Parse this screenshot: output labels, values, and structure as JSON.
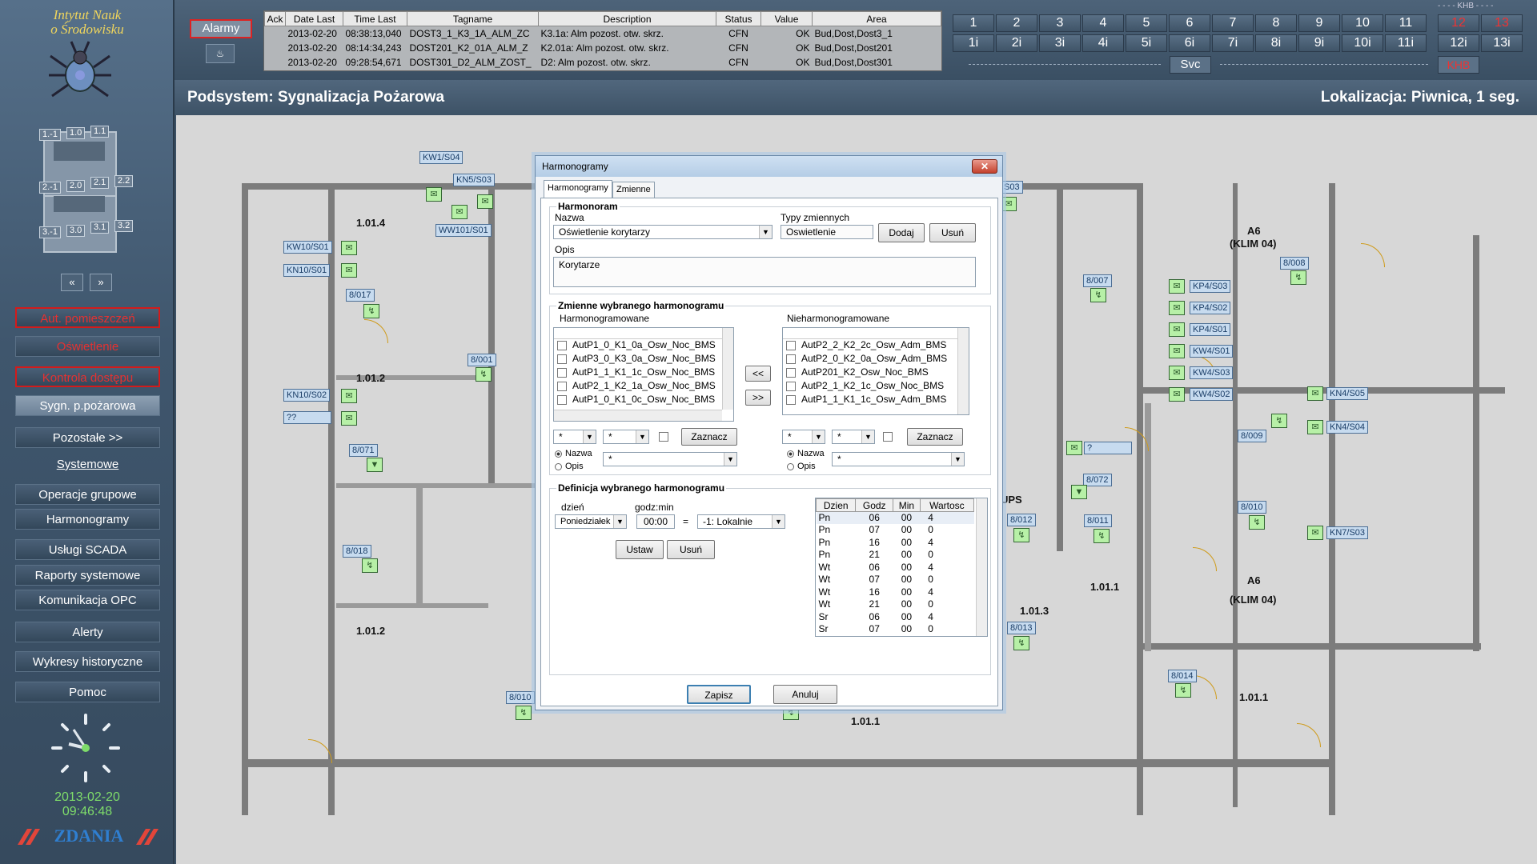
{
  "sidebar": {
    "logo_line1": "Intytut Nauk",
    "logo_line2": "o Środowisku",
    "floor_labels": [
      "1.-1",
      "1.0",
      "1.1",
      "2.-1",
      "2.0",
      "2.1",
      "2.2",
      "3.-1",
      "3.0",
      "3.1",
      "3.2"
    ],
    "prev_label": "«",
    "next_label": "»",
    "menu": [
      {
        "label": "Aut. pomieszczeń",
        "style": "red"
      },
      {
        "label": "Oświetlenie",
        "style": "redtext"
      },
      {
        "label": "Kontrola dostępu",
        "style": "red"
      },
      {
        "label": "Sygn. p.pożarowa",
        "style": "active"
      },
      {
        "label": "Pozostałe  >>",
        "style": "normal"
      },
      {
        "label": "Systemowe",
        "style": "link"
      },
      {
        "label": "Operacje grupowe",
        "style": "normal"
      },
      {
        "label": "Harmonogramy",
        "style": "normal"
      },
      {
        "label": "Usługi SCADA",
        "style": "normal"
      },
      {
        "label": "Raporty systemowe",
        "style": "normal"
      },
      {
        "label": "Komunikacja OPC",
        "style": "normal"
      },
      {
        "label": "Alerty",
        "style": "normal"
      },
      {
        "label": "Wykresy historyczne",
        "style": "normal"
      },
      {
        "label": "Pomoc",
        "style": "normal"
      }
    ],
    "date": "2013-02-20",
    "time": "09:46:48",
    "brand": "ZDANIA"
  },
  "topbar": {
    "alarm_button": "Alarmy",
    "table_headers": [
      "Ack",
      "Date Last",
      "Time Last",
      "Tagname",
      "Description",
      "Status",
      "Value",
      "Area"
    ],
    "alarms": [
      {
        "ack": "",
        "date": "2013-02-20",
        "time": "08:38:13,040",
        "tag": "DOST3_1_K3_1A_ALM_ZC",
        "desc": "K3.1a: Alm pozost. otw. skrz.",
        "status": "CFN",
        "value": "OK",
        "area": "Bud,Dost,Dost3_1"
      },
      {
        "ack": "",
        "date": "2013-02-20",
        "time": "08:14:34,243",
        "tag": "DOST201_K2_01A_ALM_Z",
        "desc": "K2.01a: Alm pozost. otw. skrz.",
        "status": "CFN",
        "value": "OK",
        "area": "Bud,Dost,Dost201"
      },
      {
        "ack": "",
        "date": "2013-02-20",
        "time": "09:28:54,671",
        "tag": "DOST301_D2_ALM_ZOST_",
        "desc": "D2: Alm pozost. otw. skrz.",
        "status": "CFN",
        "value": "OK",
        "area": "Bud,Dost,Dost301"
      }
    ],
    "floors_top": [
      "1",
      "2",
      "3",
      "4",
      "5",
      "6",
      "7",
      "8",
      "9",
      "10",
      "11",
      "12",
      "13"
    ],
    "floors_bottom": [
      "1i",
      "2i",
      "3i",
      "4i",
      "5i",
      "6i",
      "7i",
      "8i",
      "9i",
      "10i",
      "11i",
      "12i",
      "13i"
    ],
    "khb_top": "- - - - KHB - - - -",
    "svc": "Svc",
    "khb": "KHB"
  },
  "header": {
    "subsystem": "Podsystem: Sygnalizacja Pożarowa",
    "location": "Lokalizacja: Piwnica, 1 seg."
  },
  "plan": {
    "rooms": [
      "1.01.4",
      "1.01.2",
      "1.01.2",
      "A6",
      "(KLIM 04)",
      "A6",
      "(KLIM 04)",
      "UPS",
      "1.01.3",
      "1.01.1",
      "1.01.1",
      "1.01.1"
    ],
    "tags": [
      "KW1/S04",
      "KN5/S03",
      "WW101/S01",
      "KW10/S01",
      "KN10/S01",
      "8/017",
      "8/001",
      "KN10/S02",
      "??",
      "8/071",
      "8/018",
      "8/010",
      "8/007",
      "8/008",
      "KP4/S03",
      "KP4/S02",
      "KP4/S01",
      "KW4/S01",
      "KW4/S03",
      "KW4/S02",
      "KN4/S05",
      "KN4/S04",
      "KN7/S03",
      "8/009",
      "?",
      "8/072",
      "8/012",
      "8/011",
      "8/010",
      "8/013",
      "8/014",
      "S03"
    ]
  },
  "dialog": {
    "title": "Harmonogramy",
    "close": "✕",
    "tabs": [
      "Harmonogramy",
      "Zmienne"
    ],
    "group1_title": "Harmonoram",
    "name_label": "Nazwa",
    "name_value": "Oświetlenie korytarzy",
    "types_label": "Typy zmiennych",
    "types_value": "Oswietlenie",
    "add_button": "Dodaj",
    "remove_button": "Usuń",
    "desc_label": "Opis",
    "desc_value": "Korytarze",
    "group2_title": "Zmienne wybranego harmonogramu",
    "scheduled_label": "Harmonogramowane",
    "unscheduled_label": "Nieharmonogramowane",
    "scheduled_items": [
      "AutP1_0_K1_0a_Osw_Noc_BMS",
      "AutP3_0_K3_0a_Osw_Noc_BMS",
      "AutP1_1_K1_1c_Osw_Noc_BMS",
      "AutP2_1_K2_1a_Osw_Noc_BMS",
      "AutP1_0_K1_0c_Osw_Noc_BMS"
    ],
    "unscheduled_items": [
      "AutP2_2_K2_2c_Osw_Adm_BMS",
      "AutP2_0_K2_0a_Osw_Adm_BMS",
      "AutP201_K2_Osw_Noc_BMS",
      "AutP2_1_K2_1c_Osw_Noc_BMS",
      "AutP1_1_K1_1c_Osw_Adm_BMS"
    ],
    "move_left": "<<",
    "move_right": ">>",
    "filter_value": "*",
    "mark_button": "Zaznacz",
    "radio_name": "Nazwa",
    "radio_desc": "Opis",
    "group3_title": "Definicja wybranego harmonogramu",
    "day_label": "dzień",
    "day_value": "Poniedziałek",
    "time_label": "godz:min",
    "time_value": "00:00",
    "equals": "=",
    "value_value": "-1: Lokalnie",
    "set_button": "Ustaw",
    "delete_button": "Usuń",
    "sched_headers": [
      "Dzien",
      "Godz",
      "Min",
      "Wartosc"
    ],
    "sched_rows": [
      [
        "Pn",
        "06",
        "00",
        "4"
      ],
      [
        "Pn",
        "07",
        "00",
        "0"
      ],
      [
        "Pn",
        "16",
        "00",
        "4"
      ],
      [
        "Pn",
        "21",
        "00",
        "0"
      ],
      [
        "Wt",
        "06",
        "00",
        "4"
      ],
      [
        "Wt",
        "07",
        "00",
        "0"
      ],
      [
        "Wt",
        "16",
        "00",
        "4"
      ],
      [
        "Wt",
        "21",
        "00",
        "0"
      ],
      [
        "Sr",
        "06",
        "00",
        "4"
      ],
      [
        "Sr",
        "07",
        "00",
        "0"
      ]
    ],
    "save_button": "Zapisz",
    "cancel_button": "Anuluj"
  },
  "colors": {
    "sidebar_bg": "#3f566d",
    "alarm_red": "#e53131",
    "clock_green": "#7edc6a",
    "device_green": "#b7f0a7",
    "door_orange": "#cf9b1b",
    "plan_bg": "#d7d7d7"
  }
}
